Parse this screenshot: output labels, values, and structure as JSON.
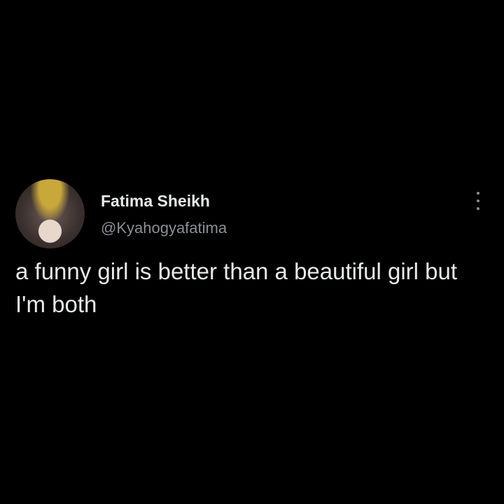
{
  "tweet": {
    "author_name": "Fatima Sheikh",
    "author_handle": "@Kyahogyafatima",
    "text": "a funny girl is better than a beautiful girl but I'm both",
    "more_icon": "more-vertical-icon"
  }
}
